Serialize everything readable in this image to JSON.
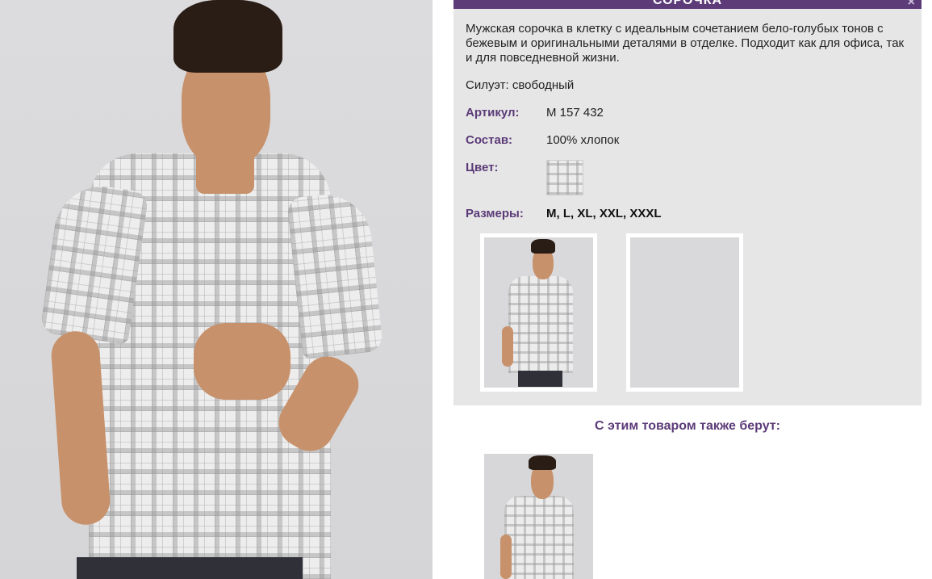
{
  "product": {
    "title": "СОРОЧКА",
    "close_icon": "×",
    "description": "Мужская сорочка в клетку с идеальным сочетанием бело-голубых тонов с бежевым и оригинальными деталями в отделке. Подходит как для офиса, так и для повседневной жизни.",
    "silhouette": "Силуэт: свободный",
    "article_label": "Артикул:",
    "article_value": "M 157 432",
    "composition_label": "Состав:",
    "composition_value": "100% хлопок",
    "color_label": "Цвет:",
    "sizes_label": "Размеры:",
    "sizes_value": "M, L, XL, XXL, XXXL"
  },
  "related": {
    "title": "С этим товаром также берут:"
  },
  "colors": {
    "accent": "#5c3b78",
    "panel_bg": "#e6e6e6"
  }
}
